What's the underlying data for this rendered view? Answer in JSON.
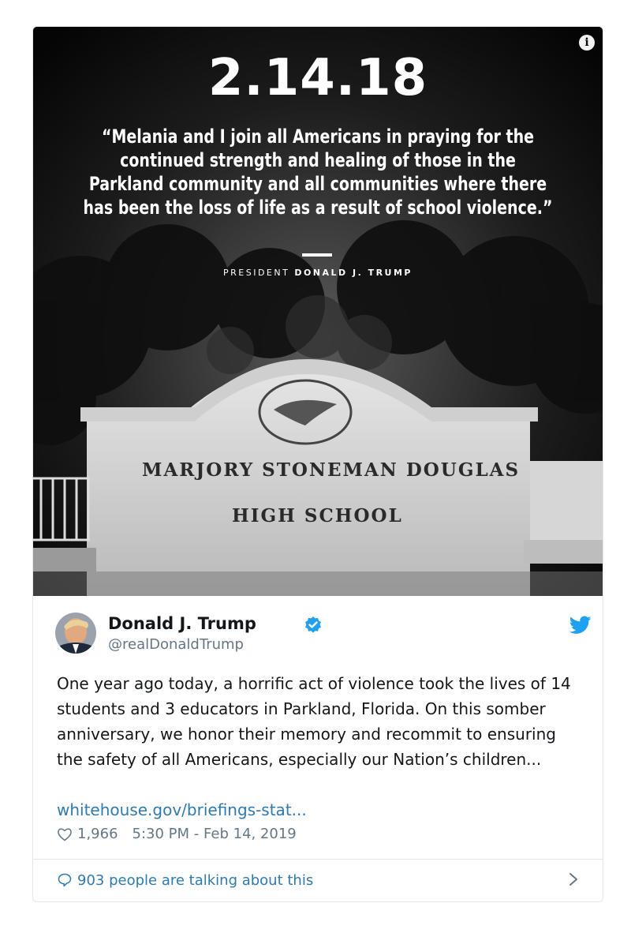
{
  "media": {
    "date": "2.14.18",
    "quote": "“Melania and I join all Americans in praying for the continued strength and healing of those in the Parkland community and all communities where there has been the loss of life as a result of school violence.”",
    "attribution_prefix": "PRESIDENT ",
    "attribution_name": "DONALD J. TRUMP",
    "sign_line1": "MARJORY STONEMAN DOUGLAS",
    "sign_line2": "HIGH SCHOOL",
    "info_icon": "info-icon"
  },
  "tweet": {
    "name": "Donald J. Trump",
    "handle": "@realDonaldTrump",
    "text": "One year ago today, a horrific act of violence took the lives of 14 students and 3 educators in Parkland, Florida. On this somber anniversary, we honor their memory and recommit to ensuring the safety of all Americans, especially our Nation’s children...",
    "link": "whitehouse.gov/briefings-stat...",
    "likes": "1,966",
    "timestamp": "5:30 PM - Feb 14, 2019",
    "talking": "903 people are talking about this"
  },
  "colors": {
    "link": "#2b7bb9",
    "verified": "#1da1f2",
    "muted": "#657786"
  }
}
